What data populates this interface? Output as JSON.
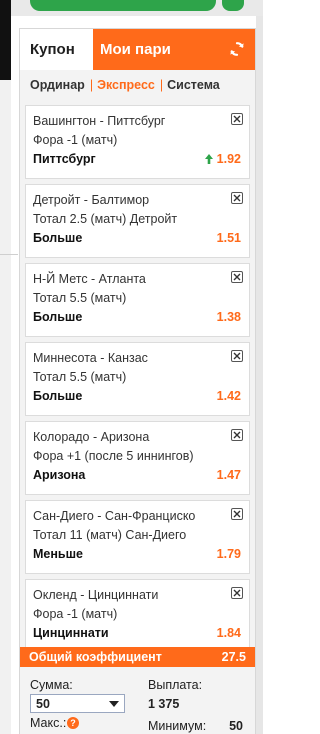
{
  "tabs": {
    "coupon": "Купон",
    "my_bets": "Мои пари"
  },
  "modes": {
    "single": "Ординар",
    "express": "Экспресс",
    "system": "Система",
    "separator": "|"
  },
  "bets": [
    {
      "match": "Вашингтон - Питтсбург",
      "market": "Фора -1 (матч)",
      "pick": "Питтсбург",
      "odds": "1.92",
      "trend": "up"
    },
    {
      "match": "Детройт - Балтимор",
      "market": "Тотал 2.5 (матч) Детройт",
      "pick": "Больше",
      "odds": "1.51"
    },
    {
      "match": "Н-Й Метс - Атланта",
      "market": "Тотал 5.5 (матч)",
      "pick": "Больше",
      "odds": "1.38"
    },
    {
      "match": "Миннесота - Канзас",
      "market": "Тотал 5.5 (матч)",
      "pick": "Больше",
      "odds": "1.42"
    },
    {
      "match": "Колорадо - Аризона",
      "market": "Фора +1 (после 5 иннингов)",
      "pick": "Аризона",
      "odds": "1.47"
    },
    {
      "match": "Сан-Диего - Сан-Франциско",
      "market": "Тотал 11 (матч) Сан-Диего",
      "pick": "Меньше",
      "odds": "1.79"
    },
    {
      "match": "Окленд - Цинциннати",
      "market": "Фора -1 (матч)",
      "pick": "Цинциннати",
      "odds": "1.84"
    }
  ],
  "total": {
    "label": "Общий коэффициент",
    "value": "27.5"
  },
  "stake": {
    "label": "Сумма:",
    "value": "50",
    "payout_label": "Выплата:",
    "payout_value": "1 375",
    "max_label": "Макс.:",
    "help": "?",
    "min_label": "Минимум:",
    "min_value": "50"
  },
  "colors": {
    "accent": "#ff6a1a",
    "up_arrow": "#2ea44a",
    "header_green": "#2ea44a"
  },
  "icons": {
    "refresh": "refresh-icon",
    "remove": "close-box-icon",
    "trend": "arrow-up-icon"
  }
}
